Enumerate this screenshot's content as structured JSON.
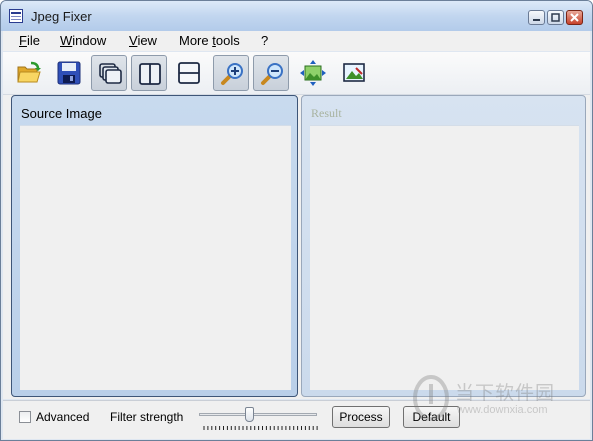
{
  "window": {
    "title": "Jpeg Fixer"
  },
  "menu": [
    {
      "pre": "",
      "ul": "F",
      "post": "ile"
    },
    {
      "pre": "",
      "ul": "W",
      "post": "indow"
    },
    {
      "pre": "",
      "ul": "V",
      "post": "iew"
    },
    {
      "pre": "More ",
      "ul": "t",
      "post": "ools"
    },
    {
      "pre": "?",
      "ul": "",
      "post": ""
    }
  ],
  "toolbar": [
    {
      "name": "open-folder-icon",
      "pressed": false
    },
    {
      "name": "save-disk-icon",
      "pressed": false
    },
    {
      "name": "cascade-windows-icon",
      "pressed": true
    },
    {
      "name": "tile-vertical-icon",
      "pressed": true
    },
    {
      "name": "tile-horizontal-icon",
      "pressed": false
    },
    {
      "name": "zoom-in-icon",
      "pressed": true
    },
    {
      "name": "zoom-out-icon",
      "pressed": true
    },
    {
      "name": "fit-to-window-icon",
      "pressed": false
    },
    {
      "name": "actual-size-icon",
      "pressed": false
    }
  ],
  "panes": {
    "source": "Source Image",
    "result": "Result"
  },
  "bottom": {
    "advanced_label": "Advanced",
    "advanced_checked": false,
    "filter_label": "Filter strength",
    "filter_value_fraction": 0.42,
    "process_label": "Process",
    "default_label": "Default"
  },
  "watermark": {
    "brand": "当下软件园",
    "url": "www.downxia.com"
  },
  "colors": {
    "accent": "#b3cbea",
    "close": "#c7412b"
  }
}
